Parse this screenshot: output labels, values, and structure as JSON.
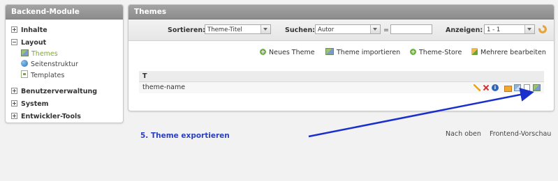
{
  "sidebar": {
    "title": "Backend-Module",
    "groups": [
      {
        "label": "Inhalte"
      },
      {
        "label": "Layout"
      },
      {
        "label": "Benutzerverwaltung"
      },
      {
        "label": "System"
      },
      {
        "label": "Entwickler-Tools"
      }
    ],
    "layout_items": [
      {
        "label": "Themes",
        "icon": "themes-icon",
        "active": true
      },
      {
        "label": "Seitenstruktur",
        "icon": "globe-icon"
      },
      {
        "label": "Templates",
        "icon": "template-icon"
      }
    ]
  },
  "main": {
    "title": "Themes",
    "filter": {
      "sort_label": "Sortieren:",
      "sort_value": "Theme-Titel",
      "search_label": "Suchen:",
      "search_field": "Autor",
      "search_operator": "=",
      "search_value": "",
      "show_label": "Anzeigen:",
      "show_value": "1 - 1"
    },
    "actions": {
      "new_theme": "Neues Theme",
      "import_theme": "Theme importieren",
      "theme_store": "Theme-Store",
      "edit_multiple": "Mehrere bearbeiten"
    },
    "table": {
      "header": "T",
      "rows": [
        {
          "name": "theme-name"
        }
      ],
      "row_operations": [
        "pencil-icon",
        "delete-icon",
        "info-icon",
        "cut-icon",
        "copy-icon",
        "file-icon",
        "export-icon"
      ]
    }
  },
  "annotation": {
    "text": "5. Theme exportieren",
    "color": "#2a3fbf"
  },
  "footer": {
    "back_to_top": "Nach oben",
    "frontend_preview": "Frontend-Vorschau"
  },
  "colors": {
    "active_nav": "#7da82a",
    "panel_header": "#999999",
    "arrow": "#1a2fcc"
  }
}
